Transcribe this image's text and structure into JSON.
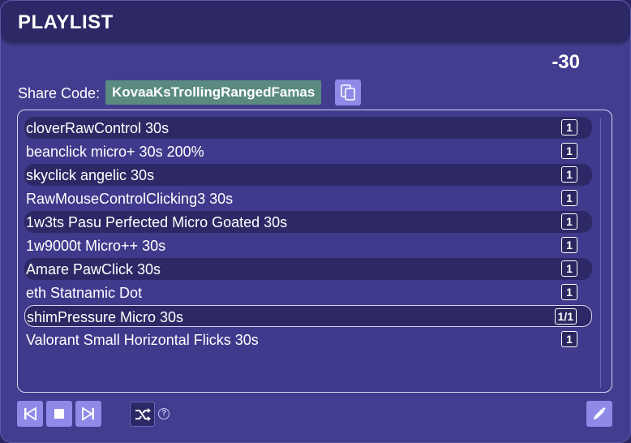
{
  "header": {
    "title": "PLAYLIST"
  },
  "score": "-30",
  "share": {
    "label": "Share Code:",
    "code": "KovaaKsTrollingRangedFamas"
  },
  "playlist": [
    {
      "name": "cloverRawControl 30s",
      "count": "1"
    },
    {
      "name": "beanclick micro+ 30s 200%",
      "count": "1"
    },
    {
      "name": "skyclick angelic 30s",
      "count": "1"
    },
    {
      "name": "RawMouseControlClicking3 30s",
      "count": "1"
    },
    {
      "name": "1w3ts Pasu Perfected Micro Goated 30s",
      "count": "1"
    },
    {
      "name": "1w9000t Micro++ 30s",
      "count": "1"
    },
    {
      "name": "Amare PawClick 30s",
      "count": "1"
    },
    {
      "name": "eth Statnamic Dot",
      "count": "1"
    },
    {
      "name": "shimPressure Micro 30s",
      "count": "1/1"
    },
    {
      "name": "Valorant Small Horizontal Flicks 30s",
      "count": "1"
    }
  ],
  "current_index": 8,
  "help_glyph": "?",
  "icons": {
    "copy": "copy-icon",
    "previous": "skip-previous-icon",
    "stop": "stop-icon",
    "next": "skip-next-icon",
    "shuffle": "shuffle-icon",
    "help": "help-icon",
    "edit": "pencil-icon"
  },
  "colors": {
    "panel": "#423d8f",
    "header": "#2c2966",
    "accent_button": "#8f8ae8",
    "share_code_bg": "#5a8a80"
  }
}
